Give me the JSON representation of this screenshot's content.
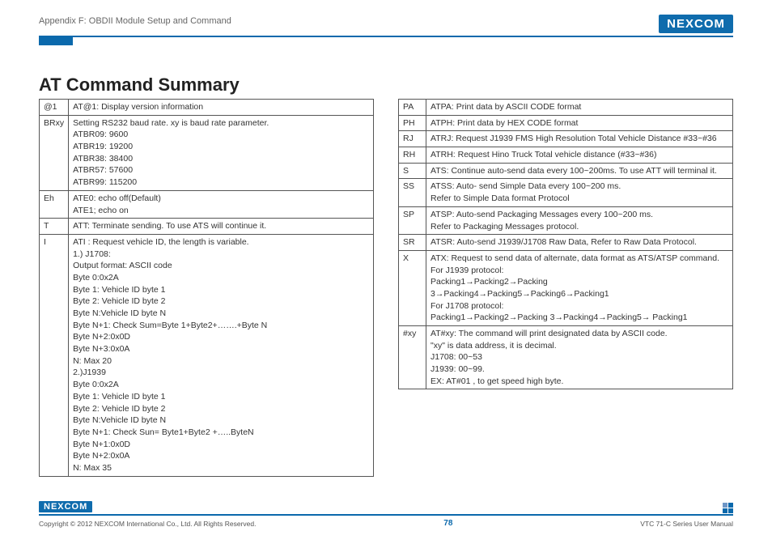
{
  "header": {
    "section": "Appendix F: OBDII Module Setup and Command",
    "brand": "NEXCOM"
  },
  "title": "AT Command Summary",
  "left_rows": [
    {
      "cmd": "@1",
      "desc": "AT@1: Display version information"
    },
    {
      "cmd": "BRxy",
      "desc": "Setting RS232 baud rate. xy is baud rate parameter.\nATBR09: 9600\nATBR19: 19200\nATBR38: 38400\nATBR57: 57600\nATBR99: 115200"
    },
    {
      "cmd": "Eh",
      "desc": "ATE0: echo off(Default)\nATE1; echo on"
    },
    {
      "cmd": "T",
      "desc": "ATT: Terminate sending. To use ATS will continue it."
    },
    {
      "cmd": "I",
      "desc": "ATI : Request vehicle ID, the length is variable.\n1.) J1708:\nOutput format: ASCII code\nByte 0:0x2A\nByte 1: Vehicle ID byte 1\nByte 2: Vehicle ID byte 2\nByte N:Vehicle ID byte N\nByte N+1: Check Sum=Byte 1+Byte2+…….+Byte N\nByte N+2:0x0D\nByte N+3:0x0A\nN: Max 20\n2.)J1939\nByte 0:0x2A\nByte 1: Vehicle ID byte 1\nByte 2: Vehicle ID byte 2\nByte N:Vehicle ID byte N\nByte N+1: Check Sun= Byte1+Byte2 +…..ByteN\nByte N+1:0x0D\nByte N+2:0x0A\nN: Max 35"
    }
  ],
  "right_rows": [
    {
      "cmd": "PA",
      "desc": "ATPA: Print data by ASCII CODE format"
    },
    {
      "cmd": "PH",
      "desc": "ATPH: Print data by HEX CODE format"
    },
    {
      "cmd": "RJ",
      "desc": "ATRJ: Request J1939 FMS High Resolution Total Vehicle Distance #33~#36"
    },
    {
      "cmd": "RH",
      "desc": "ATRH: Request Hino Truck Total vehicle distance (#33~#36)"
    },
    {
      "cmd": "S",
      "desc": "ATS: Continue auto-send data every 100~200ms. To use ATT will terminal it."
    },
    {
      "cmd": "SS",
      "desc": "ATSS: Auto- send Simple Data every 100~200 ms.\nRefer to Simple Data format Protocol"
    },
    {
      "cmd": "SP",
      "desc": "ATSP: Auto-send Packaging Messages every 100~200 ms.\nRefer to Packaging Messages protocol."
    },
    {
      "cmd": "SR",
      "desc": "ATSR: Auto-send J1939/J1708 Raw Data, Refer to Raw Data Protocol."
    },
    {
      "cmd": "X",
      "desc": "ATX: Request to send data of alternate, data format as ATS/ATSP command.\nFor J1939 protocol:\nPacking1→Packing2→Packing 3→Packing4→Packing5→Packing6→Packing1\nFor J1708 protocol:\nPacking1→Packing2→Packing 3→Packing4→Packing5→ Packing1"
    },
    {
      "cmd": "#xy",
      "desc": "AT#xy: The command will print designated data by ASCII code.\n\"xy\" is data address, it is decimal.\nJ1708: 00~53\nJ1939: 00~99.\nEX: AT#01 , to get speed high byte."
    }
  ],
  "footer": {
    "copyright": "Copyright © 2012 NEXCOM International Co., Ltd. All Rights Reserved.",
    "page": "78",
    "manual": "VTC 71-C Series User Manual"
  }
}
